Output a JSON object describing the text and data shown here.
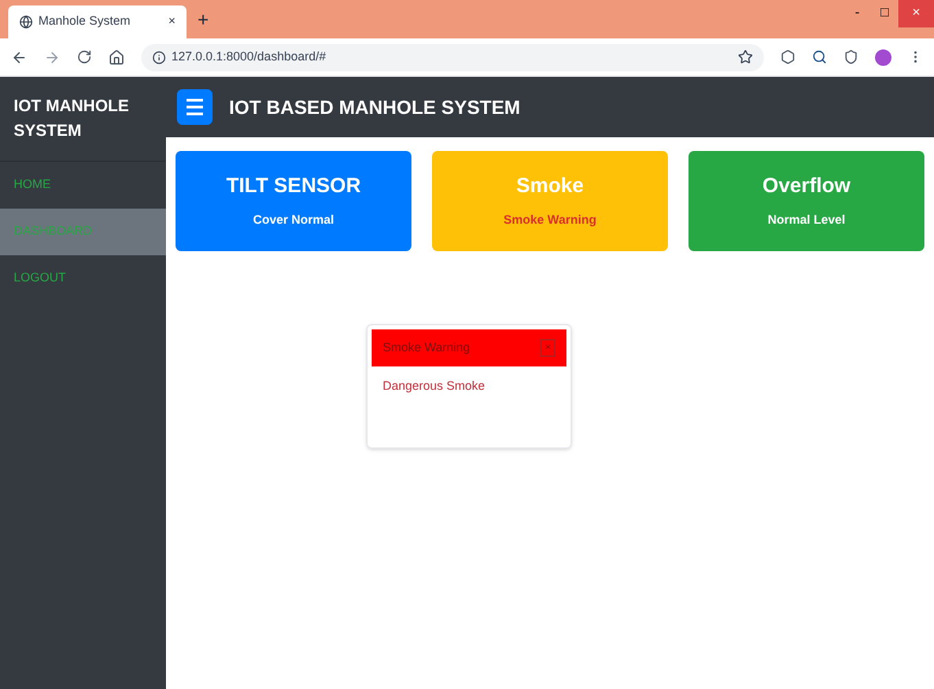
{
  "browser": {
    "tab_title": "Manhole System",
    "tab_close": "×",
    "new_tab": "+",
    "url": "127.0.0.1:8000/dashboard/#",
    "window_buttons": [
      "-",
      "□",
      "×"
    ]
  },
  "sidebar": {
    "title": "IOT MANHOLE SYSTEM",
    "items": [
      {
        "label": "HOME",
        "selected": false
      },
      {
        "label": "DASHBOARD",
        "selected": true
      },
      {
        "label": "LOGOUT",
        "selected": false
      }
    ]
  },
  "header": {
    "title": "IOT BASED MANHOLE SYSTEM"
  },
  "cards": [
    {
      "title": "TILT SENSOR",
      "status": "Cover Normal",
      "color": "#007bff",
      "alert": false
    },
    {
      "title": "Smoke",
      "status": "Smoke Warning",
      "color": "#ffc107",
      "alert": true
    },
    {
      "title": "Overflow",
      "status": "Normal Level",
      "color": "#28a745",
      "alert": false
    }
  ],
  "alert": {
    "title": "Smoke Warning",
    "message": "Dangerous Smoke",
    "close": "×"
  }
}
